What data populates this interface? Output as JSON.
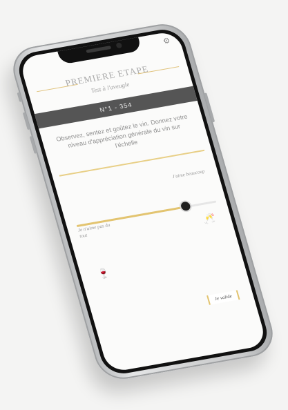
{
  "app": {
    "step_title": "PREMIERE ETAPE",
    "step_subtitle": "Test à l'aveugle",
    "sample_code": "N°1 - 354",
    "instructions": "Observez, sentez et goûtez le vin. Donnez votre niveau d'appréciation générale du vin sur l'échelle",
    "scale": {
      "low_label": "Je n'aime pas du tout",
      "high_label": "J'aime beaucoup",
      "value_fraction": 0.78
    },
    "validate_label": "Je valide"
  },
  "icons": {
    "settings": "gear-icon",
    "low_glass": "wine-glass-icon",
    "high_glass": "wine-glasses-cheers-icon"
  },
  "colors": {
    "accent": "#e3c46f",
    "band": "#555555",
    "thumb": "#1e1e1e"
  }
}
